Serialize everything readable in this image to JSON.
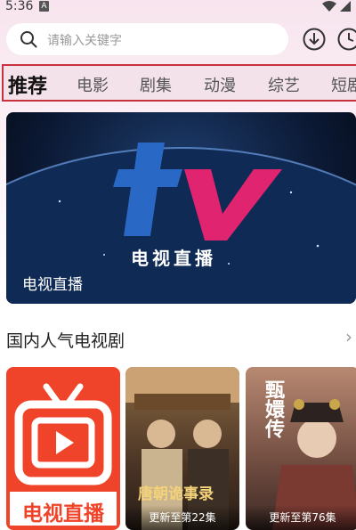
{
  "status_bar": {
    "time": "5:36",
    "notification_icon": "A"
  },
  "search": {
    "placeholder": "请输入关键字"
  },
  "tabs": [
    {
      "label": "推荐",
      "active": true
    },
    {
      "label": "电影"
    },
    {
      "label": "剧集"
    },
    {
      "label": "动漫"
    },
    {
      "label": "综艺"
    },
    {
      "label": "短剧"
    }
  ],
  "banner": {
    "logo_text": "电视直播",
    "caption": "电视直播"
  },
  "section": {
    "title": "国内人气电视剧",
    "cards": [
      {
        "title_art": "电视直播",
        "status": ""
      },
      {
        "title_art": "唐朝诡事录",
        "status": "更新至第22集"
      },
      {
        "title_art": "甄嬛传",
        "status": "更新至第76集"
      }
    ]
  },
  "colors": {
    "accent_red": "#c8323e",
    "tv_blue": "#2a68c6",
    "tv_pink": "#e0246f",
    "card_red": "#f0442a"
  }
}
